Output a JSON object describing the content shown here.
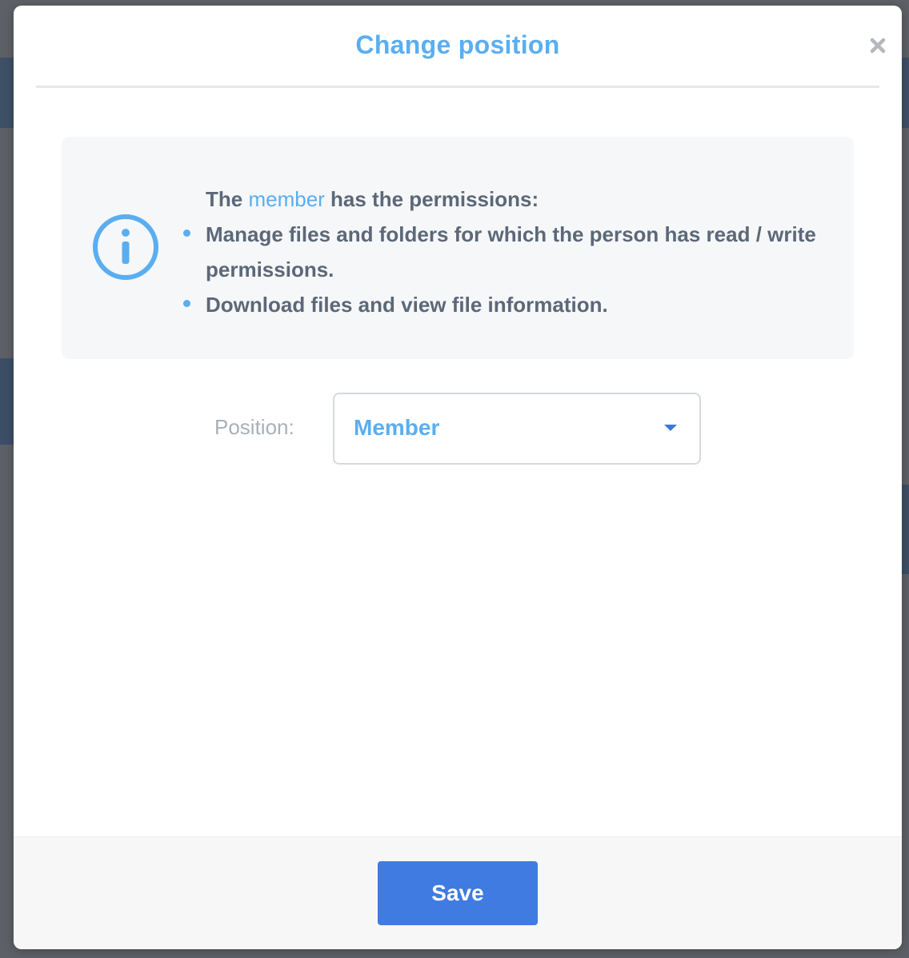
{
  "modal": {
    "title": "Change position",
    "close_icon": "close-icon"
  },
  "info": {
    "icon": "info-icon",
    "intro_prefix": "The ",
    "intro_role": "member",
    "intro_suffix": " has the permissions:",
    "permissions": [
      "Manage files and folders for which the person has read / write permissions.",
      "Download files and view file information."
    ]
  },
  "position": {
    "label": "Position:",
    "selected": "Member",
    "caret_icon": "chevron-down-icon"
  },
  "footer": {
    "save_label": "Save"
  },
  "colors": {
    "accent": "#5aaef0",
    "primary_button": "#3f7be0",
    "body_text": "#5c6878",
    "muted_label": "#a8b0ba"
  }
}
